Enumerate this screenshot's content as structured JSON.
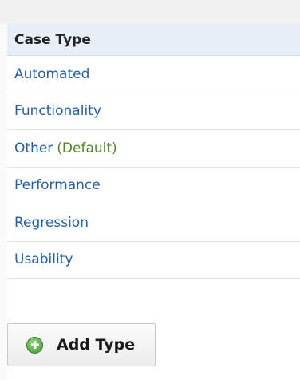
{
  "table": {
    "header": "Case Type",
    "rows": [
      {
        "label": "Automated",
        "default_tag": ""
      },
      {
        "label": "Functionality",
        "default_tag": ""
      },
      {
        "label": "Other",
        "default_tag": "(Default)"
      },
      {
        "label": "Performance",
        "default_tag": ""
      },
      {
        "label": "Regression",
        "default_tag": ""
      },
      {
        "label": "Usability",
        "default_tag": ""
      }
    ]
  },
  "actions": {
    "add_label": "Add Type",
    "add_icon": "plus-circle-icon"
  },
  "colors": {
    "link": "#1f5fb3",
    "default_tag": "#4b8a1f",
    "header_bg": "#e8eef8"
  }
}
